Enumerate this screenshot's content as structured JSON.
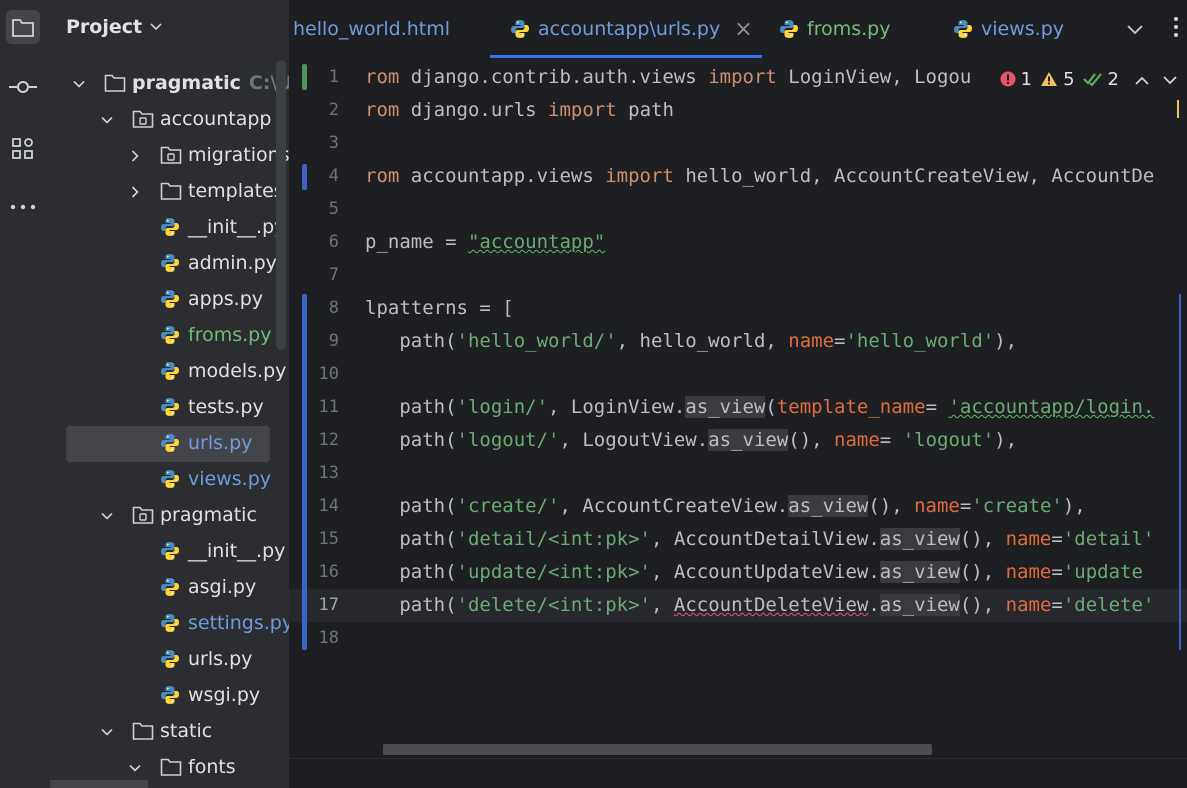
{
  "project_panel": {
    "title": "Project",
    "tree": [
      {
        "label": "pragmatic",
        "hint": "C:\\Us",
        "kind": "folder",
        "expanded": true,
        "depth": 0,
        "color": "#dfe1e5",
        "bold": true
      },
      {
        "label": "accountapp",
        "kind": "module",
        "expanded": true,
        "depth": 1,
        "color": "#dfe1e5"
      },
      {
        "label": "migrations",
        "kind": "module",
        "expanded": false,
        "depth": 2,
        "color": "#dfe1e5"
      },
      {
        "label": "templates",
        "kind": "folder",
        "expanded": false,
        "depth": 2,
        "color": "#dfe1e5"
      },
      {
        "label": "__init__.py",
        "kind": "python",
        "depth": 2,
        "color": "#dfe1e5"
      },
      {
        "label": "admin.py",
        "kind": "python",
        "depth": 2,
        "color": "#dfe1e5"
      },
      {
        "label": "apps.py",
        "kind": "python",
        "depth": 2,
        "color": "#dfe1e5"
      },
      {
        "label": "froms.py",
        "kind": "python",
        "depth": 2,
        "color": "#73bd79"
      },
      {
        "label": "models.py",
        "kind": "python",
        "depth": 2,
        "color": "#dfe1e5"
      },
      {
        "label": "tests.py",
        "kind": "python",
        "depth": 2,
        "color": "#dfe1e5"
      },
      {
        "label": "urls.py",
        "kind": "python",
        "depth": 2,
        "color": "#6f9cdc",
        "selected": true
      },
      {
        "label": "views.py",
        "kind": "python",
        "depth": 2,
        "color": "#6f9cdc"
      },
      {
        "label": "pragmatic",
        "kind": "module",
        "expanded": true,
        "depth": 1,
        "color": "#dfe1e5"
      },
      {
        "label": "__init__.py",
        "kind": "python",
        "depth": 2,
        "color": "#dfe1e5"
      },
      {
        "label": "asgi.py",
        "kind": "python",
        "depth": 2,
        "color": "#dfe1e5"
      },
      {
        "label": "settings.py",
        "kind": "python",
        "depth": 2,
        "color": "#6f9cdc"
      },
      {
        "label": "urls.py",
        "kind": "python",
        "depth": 2,
        "color": "#dfe1e5"
      },
      {
        "label": "wsgi.py",
        "kind": "python",
        "depth": 2,
        "color": "#dfe1e5"
      },
      {
        "label": "static",
        "kind": "folder",
        "expanded": true,
        "depth": 1,
        "color": "#dfe1e5"
      },
      {
        "label": "fonts",
        "kind": "folder",
        "expanded": true,
        "depth": 2,
        "color": "#dfe1e5"
      }
    ]
  },
  "tabs": [
    {
      "label": "hello_world.html",
      "color": "#6f9cdc",
      "icon": "none",
      "active": false
    },
    {
      "label": "accountapp\\urls.py",
      "color": "#6f9cdc",
      "icon": "python-icon",
      "active": true,
      "closable": true
    },
    {
      "label": "froms.py",
      "color": "#73bd79",
      "icon": "python-icon",
      "active": false
    },
    {
      "label": "views.py",
      "color": "#6f9cdc",
      "icon": "python-icon",
      "active": false
    }
  ],
  "tab_close_glyph": "×",
  "inspections": {
    "errors": "1",
    "warnings": "5",
    "weak": "2"
  },
  "editor": {
    "current_line": 17,
    "lines": [
      {
        "n": "1",
        "tokens": [
          [
            "kw",
            "rom "
          ],
          [
            "",
            "django.contrib.auth.views "
          ],
          [
            "kw",
            "import "
          ],
          [
            "",
            "LoginView, Logou"
          ]
        ]
      },
      {
        "n": "2",
        "tokens": [
          [
            "kw",
            "rom "
          ],
          [
            "",
            "django.urls "
          ],
          [
            "kw",
            "import "
          ],
          [
            "",
            "path"
          ]
        ]
      },
      {
        "n": "3",
        "tokens": []
      },
      {
        "n": "4",
        "tokens": [
          [
            "kw",
            "rom "
          ],
          [
            "",
            "accountapp.views "
          ],
          [
            "kw",
            "import "
          ],
          [
            "",
            "hello_world, AccountCreateView, AccountDe"
          ]
        ]
      },
      {
        "n": "5",
        "tokens": []
      },
      {
        "n": "6",
        "tokens": [
          [
            "",
            "p_name = "
          ],
          [
            "str wavy-green",
            "\"accountapp\""
          ]
        ]
      },
      {
        "n": "7",
        "tokens": []
      },
      {
        "n": "8",
        "tokens": [
          [
            "",
            "lpatterns = ["
          ]
        ]
      },
      {
        "n": "9",
        "tokens": [
          [
            "",
            "   path("
          ],
          [
            "str",
            "'hello_world/'"
          ],
          [
            "",
            ", hello_world, "
          ],
          [
            "param2",
            "name"
          ],
          [
            "",
            "="
          ],
          [
            "str",
            "'hello_world'"
          ],
          [
            "",
            "),"
          ]
        ]
      },
      {
        "n": "10",
        "tokens": []
      },
      {
        "n": "11",
        "tokens": [
          [
            "",
            "   path("
          ],
          [
            "str",
            "'login/'"
          ],
          [
            "",
            ", LoginView."
          ],
          [
            "hl",
            "as_view"
          ],
          [
            "",
            "("
          ],
          [
            "param2",
            "template_name"
          ],
          [
            "",
            "= "
          ],
          [
            "str wavy-green",
            "'accountapp/login."
          ]
        ]
      },
      {
        "n": "12",
        "tokens": [
          [
            "",
            "   path("
          ],
          [
            "str",
            "'logout/'"
          ],
          [
            "",
            ", LogoutView."
          ],
          [
            "hl",
            "as_view"
          ],
          [
            "",
            "(), "
          ],
          [
            "param2",
            "name"
          ],
          [
            "",
            "= "
          ],
          [
            "str",
            "'logout'"
          ],
          [
            "",
            "),"
          ]
        ]
      },
      {
        "n": "13",
        "tokens": []
      },
      {
        "n": "14",
        "tokens": [
          [
            "",
            "   path("
          ],
          [
            "str",
            "'create/'"
          ],
          [
            "",
            ", AccountCreateView."
          ],
          [
            "hl",
            "as_view"
          ],
          [
            "",
            "(), "
          ],
          [
            "param2",
            "name"
          ],
          [
            "",
            "="
          ],
          [
            "str",
            "'create'"
          ],
          [
            "",
            "),"
          ]
        ]
      },
      {
        "n": "15",
        "tokens": [
          [
            "",
            "   path("
          ],
          [
            "str",
            "'detail/<int:pk>'"
          ],
          [
            "",
            ", AccountDetailView."
          ],
          [
            "hl",
            "as_view"
          ],
          [
            "",
            "(), "
          ],
          [
            "param2",
            "name"
          ],
          [
            "",
            "="
          ],
          [
            "str",
            "'detail'"
          ]
        ]
      },
      {
        "n": "16",
        "tokens": [
          [
            "",
            "   path("
          ],
          [
            "str",
            "'update/<int:pk>'"
          ],
          [
            "",
            ", AccountUpdateView."
          ],
          [
            "hl",
            "as_view"
          ],
          [
            "",
            "(), "
          ],
          [
            "param2",
            "name"
          ],
          [
            "",
            "="
          ],
          [
            "str",
            "'update"
          ]
        ]
      },
      {
        "n": "17",
        "tokens": [
          [
            "",
            "   path("
          ],
          [
            "str",
            "'delete/<int:pk>'"
          ],
          [
            "",
            ", "
          ],
          [
            "wavy-red",
            "AccountDeleteView"
          ],
          [
            "",
            "."
          ],
          [
            "hl",
            "as_view"
          ],
          [
            "",
            "(), "
          ],
          [
            "param2",
            "name"
          ],
          [
            "",
            "="
          ],
          [
            "str",
            "'delete'"
          ]
        ]
      },
      {
        "n": "18",
        "tokens": []
      }
    ]
  },
  "colors": {
    "accent": "#3574f0",
    "gutter_added": "#549159",
    "gutter_modified": "#3d63c7",
    "error": "#e55765",
    "warning": "#f2c55c",
    "weak_warning": "#5fb865"
  }
}
